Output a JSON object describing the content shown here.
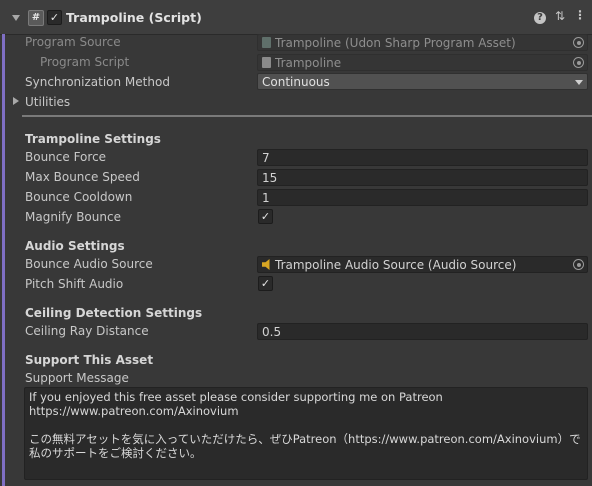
{
  "header": {
    "title": "Trampoline (Script)",
    "enabled_check": "✓",
    "script_glyph": "#",
    "help_glyph": "?",
    "presets_glyph": "⇅",
    "menu_glyph": "⋮"
  },
  "rows": {
    "program_source": {
      "label": "Program Source",
      "value": "Trampoline (Udon Sharp Program Asset)"
    },
    "program_script": {
      "label": "Program Script",
      "value": "Trampoline"
    },
    "sync_method": {
      "label": "Synchronization Method",
      "value": "Continuous"
    },
    "utilities": {
      "label": "Utilities"
    }
  },
  "trampoline_settings": {
    "header": "Trampoline Settings",
    "bounce_force": {
      "label": "Bounce Force",
      "value": "7"
    },
    "max_bounce_speed": {
      "label": "Max Bounce Speed",
      "value": "15"
    },
    "bounce_cooldown": {
      "label": "Bounce Cooldown",
      "value": "1"
    },
    "magnify_bounce": {
      "label": "Magnify Bounce",
      "checked": true,
      "check": "✓"
    }
  },
  "audio_settings": {
    "header": "Audio Settings",
    "bounce_audio_source": {
      "label": "Bounce Audio Source",
      "value": "Trampoline Audio Source (Audio Source)"
    },
    "pitch_shift_audio": {
      "label": "Pitch Shift Audio",
      "checked": true,
      "check": "✓"
    }
  },
  "ceiling_settings": {
    "header": "Ceiling Detection Settings",
    "ceiling_ray_distance": {
      "label": "Ceiling Ray Distance",
      "value": "0.5"
    }
  },
  "support": {
    "header": "Support This Asset",
    "message_label": "Support Message",
    "message": "If you enjoyed this free asset please consider supporting me on Patreon\nhttps://www.patreon.com/Axinovium\n\nこの無料アセットを気に入っていただけたら、ぜひPatreon（https://www.patreon.com/Axinovium）で\n私のサポートをご検討ください。"
  },
  "colors": {
    "accent_bar": "#7f6fc4",
    "background": "#383838",
    "field_bg": "#2a2a2a",
    "audio_icon": "#d8a623"
  }
}
